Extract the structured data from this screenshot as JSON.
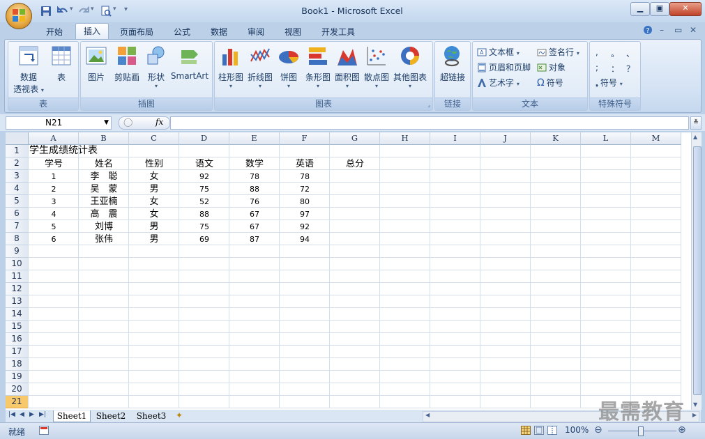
{
  "window": {
    "title": "Book1 - Microsoft Excel"
  },
  "tabs": [
    {
      "label": "开始"
    },
    {
      "label": "插入"
    },
    {
      "label": "页面布局"
    },
    {
      "label": "公式"
    },
    {
      "label": "数据"
    },
    {
      "label": "审阅"
    },
    {
      "label": "视图"
    },
    {
      "label": "开发工具"
    }
  ],
  "active_tab": "插入",
  "ribbon": {
    "table_group": {
      "label": "表",
      "pivot_line1": "数据",
      "pivot_line2": "透视表",
      "table": "表"
    },
    "illustrations_group": {
      "label": "插图",
      "picture": "图片",
      "clipart": "剪贴画",
      "shapes": "形状",
      "smartart": "SmartArt"
    },
    "charts_group": {
      "label": "图表",
      "column": "柱形图",
      "line": "折线图",
      "pie": "饼图",
      "bar": "条形图",
      "area": "面积图",
      "scatter": "散点图",
      "other": "其他图表"
    },
    "links_group": {
      "label": "链接",
      "hyperlink": "超链接"
    },
    "text_group": {
      "label": "文本",
      "textbox": "文本框",
      "header_footer": "页眉和页脚",
      "wordart": "艺术字",
      "signature": "签名行",
      "object": "对象",
      "symbol": "符号"
    },
    "special_group": {
      "label": "特殊符号",
      "chars": [
        ",",
        "。",
        "、",
        ";",
        "：",
        "？"
      ],
      "symbol": "符号"
    }
  },
  "formula_bar": {
    "name_box": "N21",
    "fx": "fx",
    "content": ""
  },
  "columns": [
    "A",
    "B",
    "C",
    "D",
    "E",
    "F",
    "G",
    "H",
    "I",
    "J",
    "K",
    "L",
    "M"
  ],
  "rows": [
    "1",
    "2",
    "3",
    "4",
    "5",
    "6",
    "7",
    "8",
    "9",
    "10",
    "11",
    "12",
    "13",
    "14",
    "15",
    "16",
    "17",
    "18",
    "19",
    "20",
    "21"
  ],
  "selected_row": "21",
  "sheet": {
    "title": "学生成绩统计表",
    "headers": [
      "学号",
      "姓名",
      "性别",
      "语文",
      "数学",
      "英语",
      "总分"
    ],
    "records": [
      [
        "1",
        "李　聪",
        "女",
        "92",
        "78",
        "78"
      ],
      [
        "2",
        "吴　蒙",
        "男",
        "75",
        "88",
        "72"
      ],
      [
        "3",
        "王亚楠",
        "女",
        "52",
        "76",
        "80"
      ],
      [
        "4",
        "高　震",
        "女",
        "88",
        "67",
        "97"
      ],
      [
        "5",
        "刘博",
        "男",
        "75",
        "67",
        "92"
      ],
      [
        "6",
        "张伟",
        "男",
        "69",
        "87",
        "94"
      ]
    ]
  },
  "sheet_tabs": [
    "Sheet1",
    "Sheet2",
    "Sheet3"
  ],
  "status": {
    "ready": "就绪",
    "zoom": "100%"
  },
  "watermark": "最需教育"
}
